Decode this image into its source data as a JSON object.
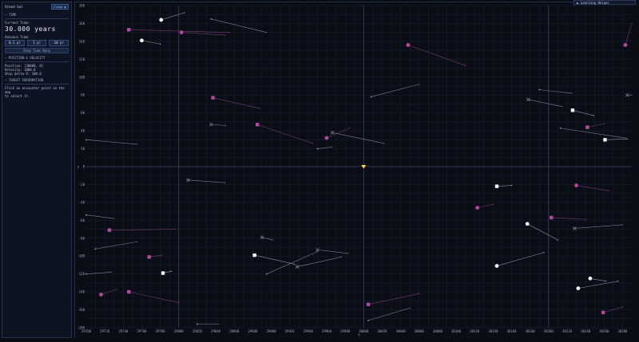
{
  "sidebar": {
    "title": "Stand Sol",
    "close_label": "Close ▶",
    "time_heading": "— TIME",
    "current_time_label": "Current Time:",
    "current_time_value": "30.000 years",
    "advance_label": "Advance Time:",
    "advance_buttons": [
      "0.1 yr",
      "1 yr",
      "10 yr"
    ],
    "stop_label": "Stop Time Warp",
    "position_heading": "— POSITION & VELOCITY",
    "position_line": "Position: [30000, 0]",
    "velocity_line": "Velocity: 1000.0",
    "ship_delta_line": "Ship delta-V: 100.0",
    "target_heading": "— TARGET INFORMATION",
    "target_hint_1": "Click an encounter point on the map",
    "target_hint_2": "to select it."
  },
  "help": {
    "label": "▶ Learning Helper"
  },
  "map": {
    "x_axis_label": "x",
    "y_axis_label": "y",
    "x_ticks": [
      "29700",
      "29720",
      "29740",
      "29760",
      "29780",
      "29800",
      "29820",
      "29840",
      "29860",
      "29880",
      "29900",
      "29920",
      "29940",
      "29960",
      "29980",
      "30000",
      "30020",
      "30040",
      "30060",
      "30080",
      "30100",
      "30120",
      "30140",
      "30160",
      "30180",
      "30200",
      "30220",
      "30240",
      "30260",
      "30280"
    ],
    "y_ticks": [
      "180",
      "160",
      "140",
      "120",
      "100",
      "80",
      "60",
      "40",
      "20",
      "0",
      "-20",
      "-40",
      "-60",
      "-80",
      "-100",
      "-120",
      "-140",
      "-160",
      "-180"
    ],
    "x_range": [
      29700,
      30290
    ],
    "y_range": [
      -180,
      180
    ],
    "colors": {
      "background": "#0a0c16",
      "grid": "#1b2438",
      "major_grid": "#3a4460",
      "magenta": "#b04aa0",
      "white": "#f0f0f0",
      "gray": "#7b8399",
      "player": "#ffd84a"
    },
    "player": {
      "x": 30000,
      "y": 0
    },
    "objects": [
      {
        "kind": "square",
        "color": "magenta",
        "x": 29746,
        "y": 153,
        "x2": 29855,
        "y2": 150
      },
      {
        "kind": "circle",
        "color": "white",
        "x": 29781,
        "y": 164,
        "x2": 29806,
        "y2": 172
      },
      {
        "kind": "circle",
        "color": "white",
        "x": 29760,
        "y": 141,
        "x2": 29780,
        "y2": 137
      },
      {
        "kind": "circle",
        "color": "magenta",
        "x": 29803,
        "y": 150,
        "x2": 29850,
        "y2": 147
      },
      {
        "kind": "dot",
        "color": "gray",
        "x": 29835,
        "y": 165,
        "x2": 29895,
        "y2": 150
      },
      {
        "kind": "circle",
        "color": "magenta",
        "x": 30048,
        "y": 136,
        "x2": 30110,
        "y2": 113
      },
      {
        "kind": "dot",
        "color": "gray",
        "x": 30008,
        "y": 78,
        "x2": 30060,
        "y2": 92
      },
      {
        "kind": "square",
        "color": "magenta",
        "x": 29837,
        "y": 77,
        "x2": 29888,
        "y2": 65
      },
      {
        "kind": "x",
        "color": "gray",
        "x": 29835,
        "y": 47,
        "x2": 29851,
        "y2": 46
      },
      {
        "kind": "square",
        "color": "magenta",
        "x": 29885,
        "y": 47,
        "x2": 29945,
        "y2": 26
      },
      {
        "kind": "circle",
        "color": "magenta",
        "x": 29960,
        "y": 32,
        "x2": 29985,
        "y2": 43
      },
      {
        "kind": "x",
        "color": "gray",
        "x": 29966,
        "y": 38,
        "x2": 30022,
        "y2": 26
      },
      {
        "kind": "dot",
        "color": "gray",
        "x": 29950,
        "y": 20,
        "x2": 29966,
        "y2": 22
      },
      {
        "kind": "dot",
        "color": "gray",
        "x": 29700,
        "y": 30,
        "x2": 29755,
        "y2": 25
      },
      {
        "kind": "square",
        "color": "magenta",
        "x": 29725,
        "y": -71,
        "x2": 29796,
        "y2": -70
      },
      {
        "kind": "dot",
        "color": "gray",
        "x": 29700,
        "y": -54,
        "x2": 29730,
        "y2": -58
      },
      {
        "kind": "dot",
        "color": "gray",
        "x": 29710,
        "y": -92,
        "x2": 29755,
        "y2": -84
      },
      {
        "kind": "square",
        "color": "magenta",
        "x": 29768,
        "y": -101,
        "x2": 29782,
        "y2": -99
      },
      {
        "kind": "square",
        "color": "white",
        "x": 29783,
        "y": -119,
        "x2": 29792,
        "y2": -117
      },
      {
        "kind": "dot",
        "color": "gray",
        "x": 29700,
        "y": -120,
        "x2": 29727,
        "y2": -118
      },
      {
        "kind": "circle",
        "color": "magenta",
        "x": 29716,
        "y": -143,
        "x2": 29733,
        "y2": -137
      },
      {
        "kind": "square",
        "color": "magenta",
        "x": 29746,
        "y": -140,
        "x2": 29800,
        "y2": -152
      },
      {
        "kind": "x",
        "color": "gray",
        "x": 29810,
        "y": -15,
        "x2": 29850,
        "y2": -18
      },
      {
        "kind": "x",
        "color": "gray",
        "x": 29890,
        "y": -79,
        "x2": 29902,
        "y2": -82
      },
      {
        "kind": "square",
        "color": "white",
        "x": 29882,
        "y": -99,
        "x2": 29925,
        "y2": -109
      },
      {
        "kind": "dot",
        "color": "gray",
        "x": 29895,
        "y": -120,
        "x2": 29950,
        "y2": -95
      },
      {
        "kind": "x",
        "color": "gray",
        "x": 29928,
        "y": -112,
        "x2": 29976,
        "y2": -101
      },
      {
        "kind": "x",
        "color": "gray",
        "x": 29950,
        "y": -93,
        "x2": 29983,
        "y2": -97
      },
      {
        "kind": "dot",
        "color": "gray",
        "x": 29820,
        "y": -176,
        "x2": 29843,
        "y2": -176
      },
      {
        "kind": "square",
        "color": "magenta",
        "x": 30005,
        "y": -154,
        "x2": 30060,
        "y2": -142
      },
      {
        "kind": "dot",
        "color": "gray",
        "x": 30005,
        "y": -172,
        "x2": 30050,
        "y2": -158
      },
      {
        "kind": "square",
        "color": "white",
        "x": 30144,
        "y": -22,
        "x2": 30160,
        "y2": -21
      },
      {
        "kind": "circle",
        "color": "magenta",
        "x": 30123,
        "y": -46,
        "x2": 30140,
        "y2": -42
      },
      {
        "kind": "circle",
        "color": "white",
        "x": 30177,
        "y": -64,
        "x2": 30210,
        "y2": -82
      },
      {
        "kind": "circle",
        "color": "white",
        "x": 30144,
        "y": -111,
        "x2": 30195,
        "y2": -96
      },
      {
        "kind": "square",
        "color": "magenta",
        "x": 30203,
        "y": -57,
        "x2": 30240,
        "y2": -59
      },
      {
        "kind": "x",
        "color": "gray",
        "x": 30228,
        "y": -69,
        "x2": 30280,
        "y2": -65
      },
      {
        "kind": "circle",
        "color": "magenta",
        "x": 30230,
        "y": -21,
        "x2": 30265,
        "y2": -27
      },
      {
        "kind": "circle",
        "color": "white",
        "x": 30232,
        "y": -136,
        "x2": 30275,
        "y2": -128
      },
      {
        "kind": "circle",
        "color": "white",
        "x": 30245,
        "y": -125,
        "x2": 30262,
        "y2": -128
      },
      {
        "kind": "square",
        "color": "magenta",
        "x": 30259,
        "y": -163,
        "x2": 30280,
        "y2": -157
      },
      {
        "kind": "x",
        "color": "gray",
        "x": 30178,
        "y": 75,
        "x2": 30215,
        "y2": 67
      },
      {
        "kind": "dot",
        "color": "gray",
        "x": 30190,
        "y": 86,
        "x2": 30225,
        "y2": 82
      },
      {
        "kind": "square",
        "color": "white",
        "x": 30226,
        "y": 63,
        "x2": 30249,
        "y2": 57
      },
      {
        "kind": "square",
        "color": "magenta",
        "x": 30242,
        "y": 44,
        "x2": 30260,
        "y2": 48
      },
      {
        "kind": "square",
        "color": "white",
        "x": 30261,
        "y": 30,
        "x2": 30285,
        "y2": 31
      },
      {
        "kind": "dot",
        "color": "gray",
        "x": 30213,
        "y": 43,
        "x2": 30283,
        "y2": 32
      },
      {
        "kind": "circle",
        "color": "magenta",
        "x": 30283,
        "y": 136,
        "x2": 30290,
        "y2": 160
      },
      {
        "kind": "x",
        "color": "gray",
        "x": 30285,
        "y": 80,
        "x2": 30290,
        "y2": 80
      }
    ]
  }
}
